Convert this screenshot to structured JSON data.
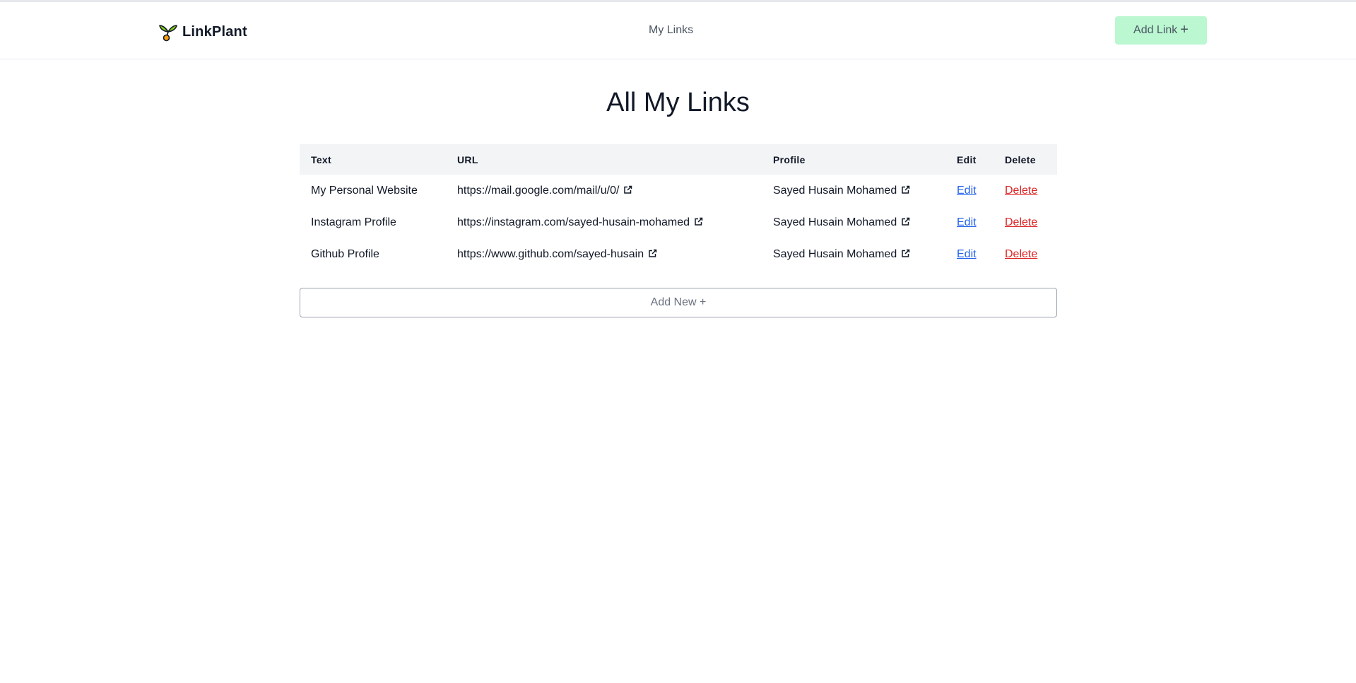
{
  "brand": {
    "name": "LinkPlant",
    "icon": "sprout-icon"
  },
  "nav": {
    "my_links": "My Links"
  },
  "header": {
    "add_link_label": "Add Link",
    "add_link_icon": "+"
  },
  "page": {
    "title": "All My Links"
  },
  "table": {
    "columns": [
      "Text",
      "URL",
      "Profile",
      "Edit",
      "Delete"
    ],
    "rows": [
      {
        "text": "My Personal Website",
        "url": "https://mail.google.com/mail/u/0/",
        "profile": "Sayed Husain Mohamed",
        "edit": "Edit",
        "delete": "Delete"
      },
      {
        "text": "Instagram Profile",
        "url": "https://instagram.com/sayed-husain-mohamed",
        "profile": "Sayed Husain Mohamed",
        "edit": "Edit",
        "delete": "Delete"
      },
      {
        "text": "Github Profile",
        "url": "https://www.github.com/sayed-husain",
        "profile": "Sayed Husain Mohamed",
        "edit": "Edit",
        "delete": "Delete"
      }
    ]
  },
  "add_new": {
    "label": "Add New +"
  },
  "colors": {
    "accent_button": "#bbf7d0",
    "edit_link": "#2563eb",
    "delete_link": "#dc2626",
    "table_header_bg": "#f3f4f6"
  }
}
